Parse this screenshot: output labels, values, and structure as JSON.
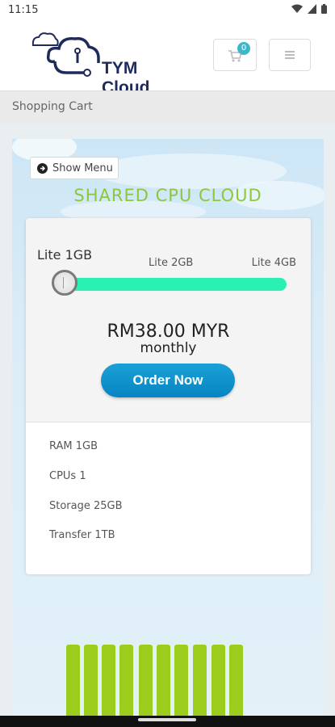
{
  "status_bar": {
    "time": "11:15"
  },
  "header": {
    "logo_text": "TYM Cloud",
    "cart_count": "0"
  },
  "breadcrumb": "Shopping Cart",
  "hero": {
    "show_menu_label": "Show Menu",
    "title": "SHARED CPU CLOUD"
  },
  "product": {
    "slider": {
      "current_label": "Lite 1GB",
      "options": [
        "Lite 1GB",
        "Lite 2GB",
        "Lite 4GB"
      ],
      "selected_index": 0
    },
    "price": "RM38.00 MYR",
    "period": "monthly",
    "order_label": "Order Now",
    "specs": [
      "RAM 1GB",
      "CPUs 1",
      "Storage 25GB",
      "Transfer 1TB"
    ]
  },
  "colors": {
    "accent": "#0c8fcb",
    "slider": "#2af0b1",
    "title_green": "#8dc63f",
    "badge": "#3fb7c9"
  }
}
